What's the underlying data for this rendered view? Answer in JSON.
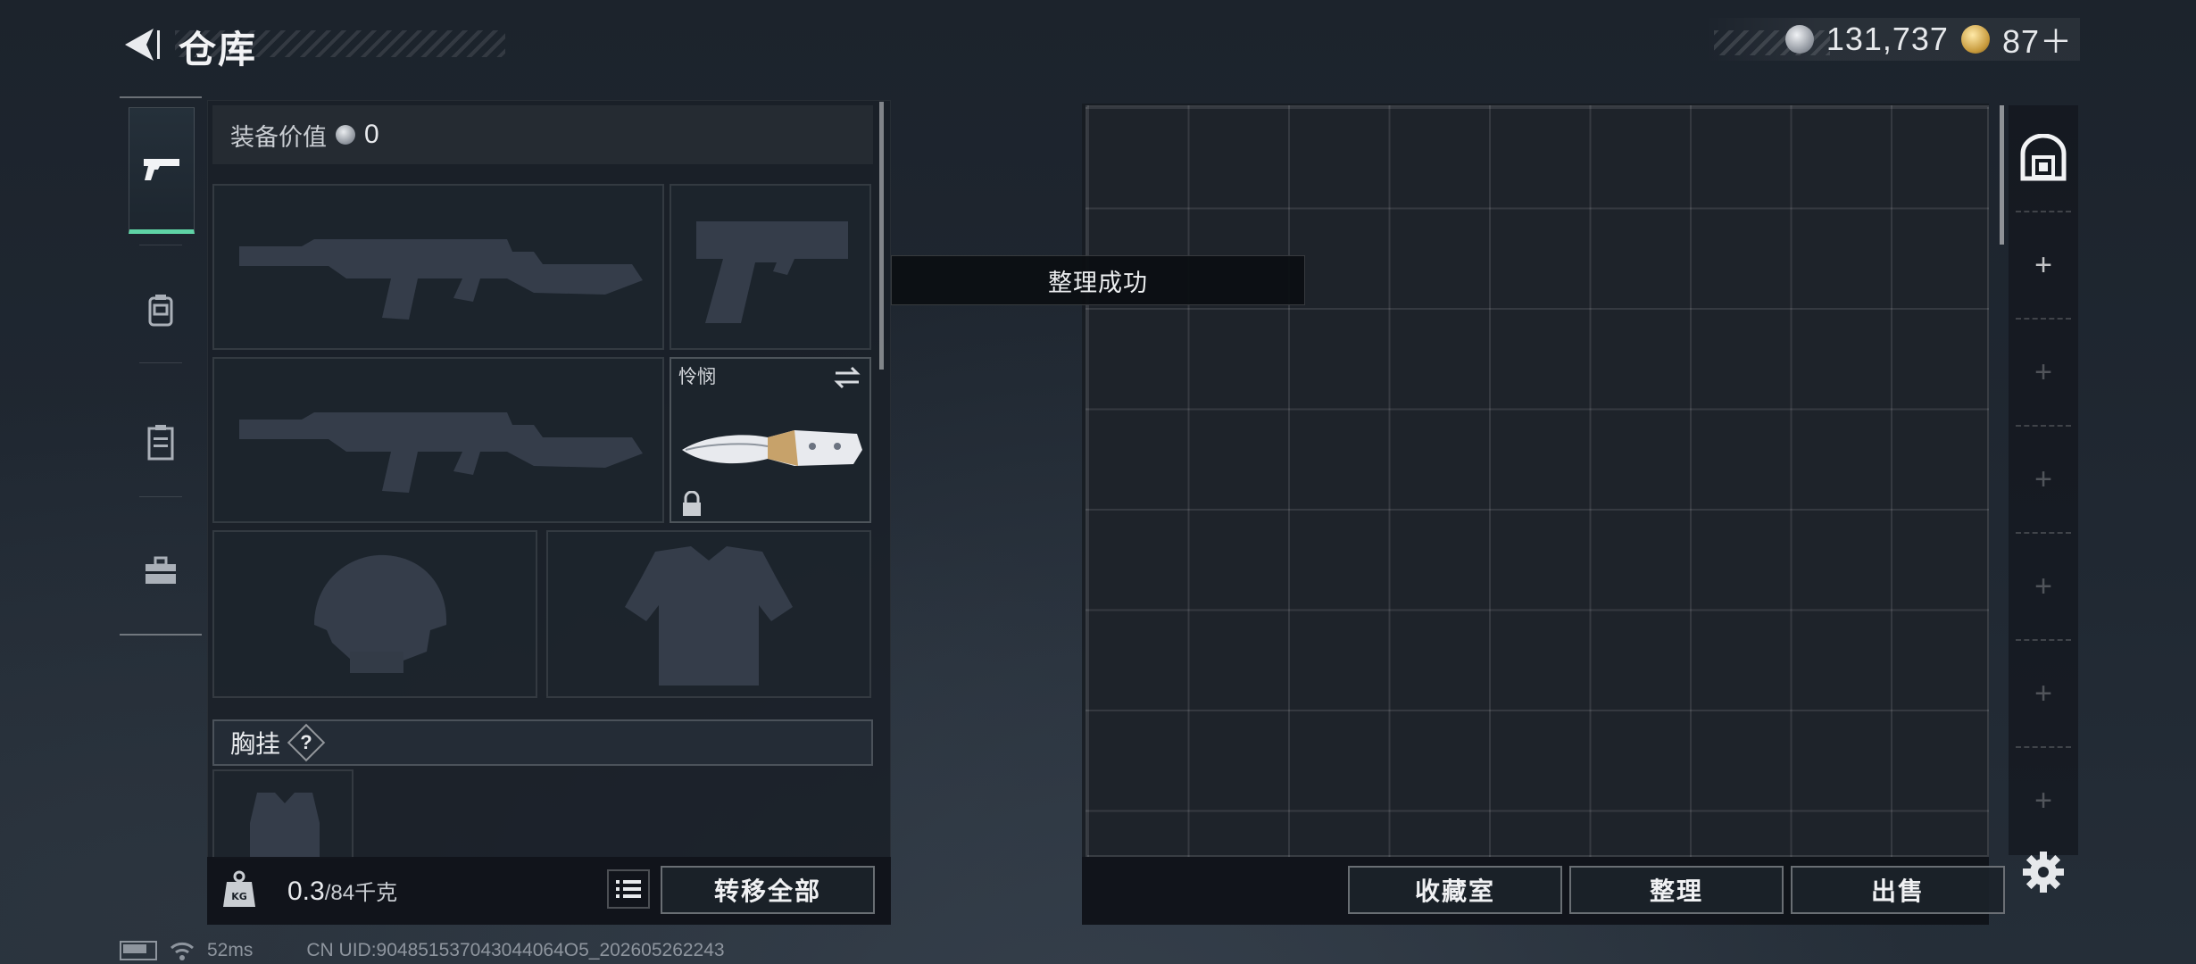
{
  "header": {
    "title": "仓库",
    "currency_silver": "131,737",
    "currency_gold": "87＋"
  },
  "equipment": {
    "value_label": "装备价值",
    "value": "0",
    "melee_name": "怜悯",
    "chest_rig_label": "胸挂",
    "help_glyph": "?"
  },
  "footer_left": {
    "weight_current": "0.3",
    "weight_capacity": "/84千克",
    "transfer_all_label": "转移全部"
  },
  "toast": {
    "message": "整理成功"
  },
  "footer_right": {
    "collection_label": "收藏室",
    "organize_label": "整理",
    "sell_label": "出售"
  },
  "side_slots": [
    "+",
    "+",
    "+",
    "+",
    "+",
    "+"
  ],
  "status": {
    "ping": "52ms",
    "uid": "CN UID:904851537043044064O5_202605262243"
  },
  "colors": {
    "accent_tab": "#5fd3a6"
  },
  "icons": {
    "back": "back-arrow-icon",
    "silver": "silver-coin-icon",
    "gold": "gold-coin-icon",
    "tabs": [
      "pistol-icon",
      "backpack-icon",
      "locker-icon",
      "toolbox-icon"
    ],
    "safe": "safe-box-icon",
    "settings": "gear-icon"
  }
}
